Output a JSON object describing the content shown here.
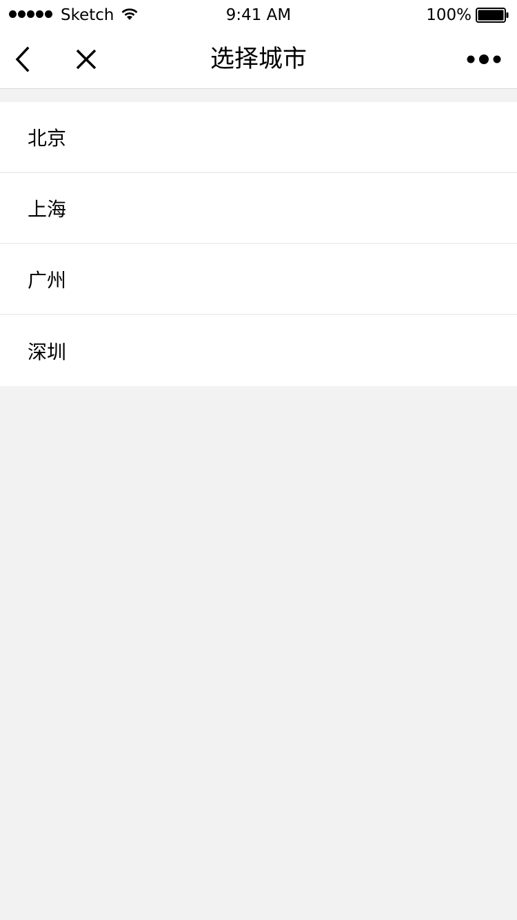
{
  "status_bar": {
    "carrier": "Sketch",
    "time": "9:41 AM",
    "battery": "100%"
  },
  "nav": {
    "title": "选择城市",
    "icons": [
      "back-chevron-icon",
      "close-icon",
      "more-icon"
    ]
  },
  "cities": [
    {
      "label": "北京"
    },
    {
      "label": "上海"
    },
    {
      "label": "广州"
    },
    {
      "label": "深圳"
    }
  ],
  "colors": {
    "background": "#f2f2f2",
    "surface": "#ffffff",
    "divider": "#efefef",
    "text": "#000000"
  }
}
